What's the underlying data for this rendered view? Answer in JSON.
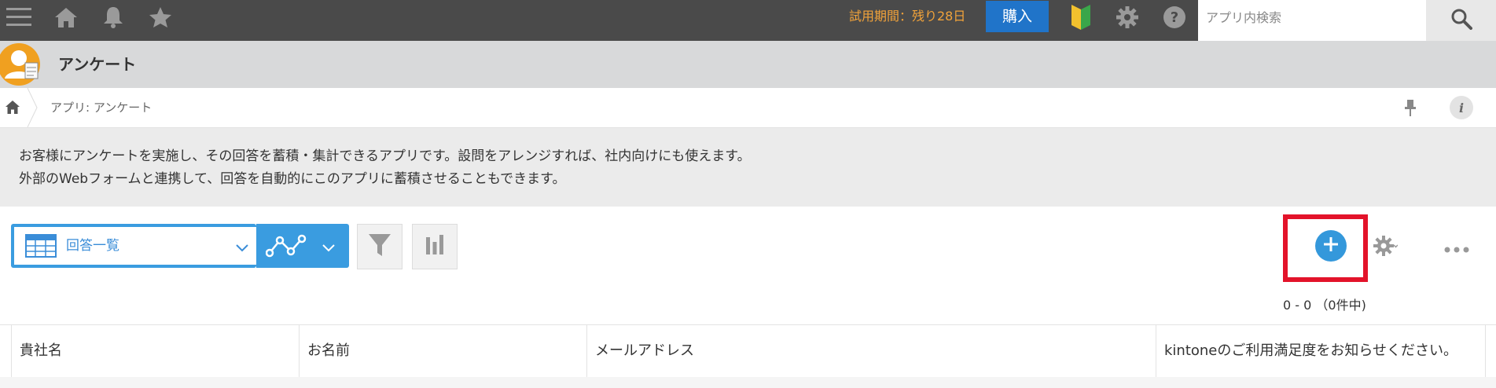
{
  "topbar": {
    "trial_text": "試用期間：残り28日",
    "buy_label": "購入",
    "search_placeholder": "アプリ内検索",
    "icons": [
      "menu-icon",
      "home-icon",
      "bell-icon",
      "star-icon",
      "beginner-mark-icon",
      "gear-icon",
      "help-icon",
      "search-icon"
    ]
  },
  "app": {
    "title": "アンケート"
  },
  "breadcrumb": {
    "text": "アプリ: アンケート"
  },
  "description": {
    "line1": "お客様にアンケートを実施し、その回答を蓄積・集計できるアプリです。設問をアレンジすれば、社内向けにも使えます。",
    "line2": "外部のWebフォームと連携して、回答を自動的にこのアプリに蓄積させることもできます。"
  },
  "toolbar": {
    "view_label": "回答一覧",
    "count_text": "0 - 0 （0件中)"
  },
  "table": {
    "columns": [
      "貴社名",
      "お名前",
      "メールアドレス",
      "kintoneのご利用満足度をお知らせください。"
    ]
  },
  "colors": {
    "topbar_bg": "#4a4a4a",
    "accent_blue": "#3a9ce0",
    "buy_blue": "#2074c9",
    "trial_orange": "#f2a33a",
    "highlight_red": "#e3132a"
  }
}
